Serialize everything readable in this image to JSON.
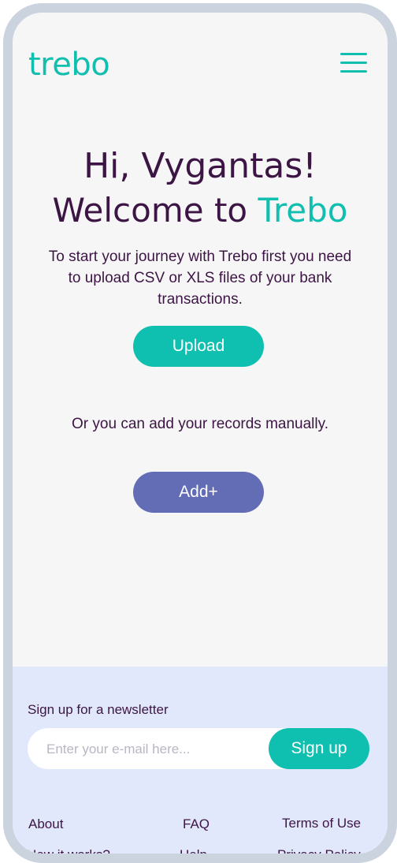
{
  "header": {
    "logo": "trebo",
    "menu_icon": "hamburger-menu-icon"
  },
  "hero": {
    "greeting": "Hi, Vygantas!",
    "welcome_prefix": "Welcome to ",
    "welcome_brand": "Trebo",
    "intro": "To start your journey with Trebo first you need to upload CSV or XLS files of your bank transactions.",
    "upload_label": "Upload",
    "manual_text": "Or you can add your records manually.",
    "add_label": "Add+"
  },
  "footer": {
    "newsletter_title": "Sign up for a newsletter",
    "email_placeholder": "Enter your e-mail here...",
    "signup_label": "Sign up",
    "links": [
      "About",
      "FAQ",
      "Terms of Use",
      "How it works?",
      "Help",
      "Privacy Policy"
    ]
  },
  "colors": {
    "accent": "#0fbfb0",
    "secondary": "#636db5",
    "text": "#3d1545",
    "footer_bg": "#e2e8fb",
    "frame": "#cbd3df"
  }
}
